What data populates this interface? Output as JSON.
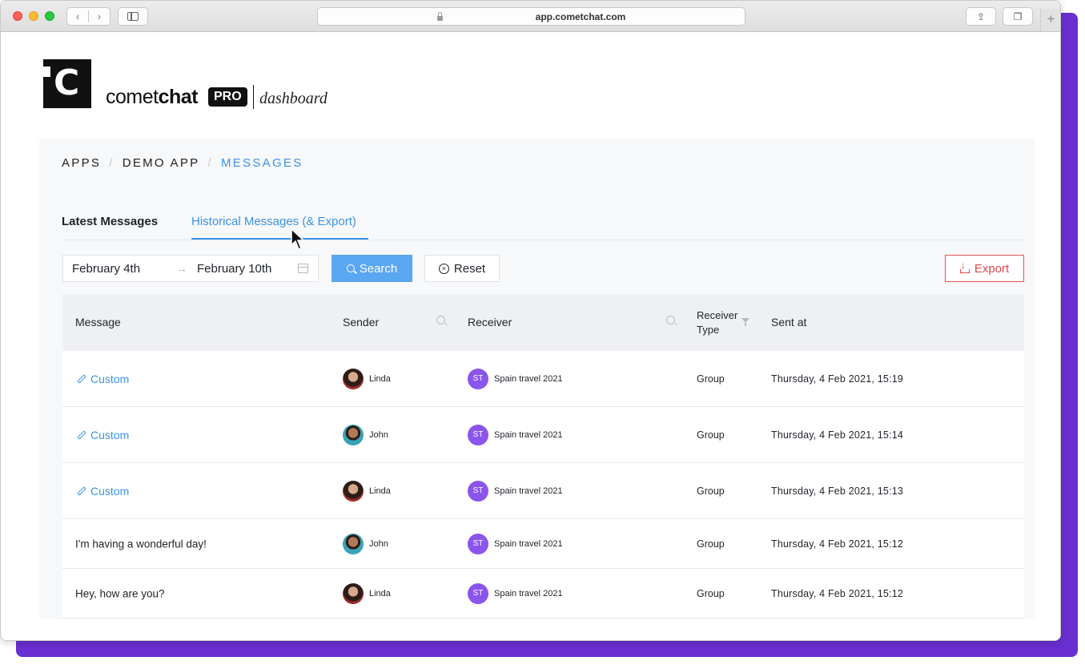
{
  "browser": {
    "url": "app.cometchat.com",
    "nav_back": "‹",
    "nav_forward": "›",
    "share_glyph": "⇪",
    "tabs_glyph": "❐",
    "new_tab": "+"
  },
  "brand": {
    "logo_letter": "C",
    "name_light": "comet",
    "name_bold": "chat",
    "badge": "PRO",
    "suffix": "dashboard"
  },
  "breadcrumb": {
    "items": [
      "APPS",
      "DEMO APP",
      "MESSAGES"
    ],
    "separator": "/"
  },
  "tabs": [
    {
      "label": "Latest Messages",
      "active": false
    },
    {
      "label": "Historical Messages (& Export)",
      "active": true
    }
  ],
  "filters": {
    "date_start": "February 4th",
    "date_arrow": "→",
    "date_end": "February 10th",
    "search_label": "Search",
    "reset_label": "Reset",
    "export_label": "Export"
  },
  "table": {
    "columns": {
      "message": "Message",
      "sender": "Sender",
      "receiver": "Receiver",
      "receiver_type": "Receiver Type",
      "receiver_type_line1": "Receiver",
      "receiver_type_line2": "Type",
      "sent_at": "Sent at"
    },
    "rows": [
      {
        "message": "Custom",
        "is_custom": true,
        "sender": "Linda",
        "receiver_initials": "ST",
        "receiver": "Spain travel 2021",
        "type": "Group",
        "sent_at": "Thursday, 4 Feb 2021, 15:19"
      },
      {
        "message": "Custom",
        "is_custom": true,
        "sender": "John",
        "receiver_initials": "ST",
        "receiver": "Spain travel 2021",
        "type": "Group",
        "sent_at": "Thursday, 4 Feb 2021, 15:14"
      },
      {
        "message": "Custom",
        "is_custom": true,
        "sender": "Linda",
        "receiver_initials": "ST",
        "receiver": "Spain travel 2021",
        "type": "Group",
        "sent_at": "Thursday, 4 Feb 2021, 15:13"
      },
      {
        "message": "I'm having a wonderful day!",
        "is_custom": false,
        "sender": "John",
        "receiver_initials": "ST",
        "receiver": "Spain travel 2021",
        "type": "Group",
        "sent_at": "Thursday, 4 Feb 2021, 15:12"
      },
      {
        "message": "Hey, how are you?",
        "is_custom": false,
        "sender": "Linda",
        "receiver_initials": "ST",
        "receiver": "Spain travel 2021",
        "type": "Group",
        "sent_at": "Thursday, 4 Feb 2021, 15:12"
      }
    ]
  },
  "colors": {
    "accent": "#3b93e5",
    "search_button": "#59a6f1",
    "export": "#e04848",
    "receiver_badge": "#8a55ec",
    "frame_purple": "#6a2fd0"
  }
}
